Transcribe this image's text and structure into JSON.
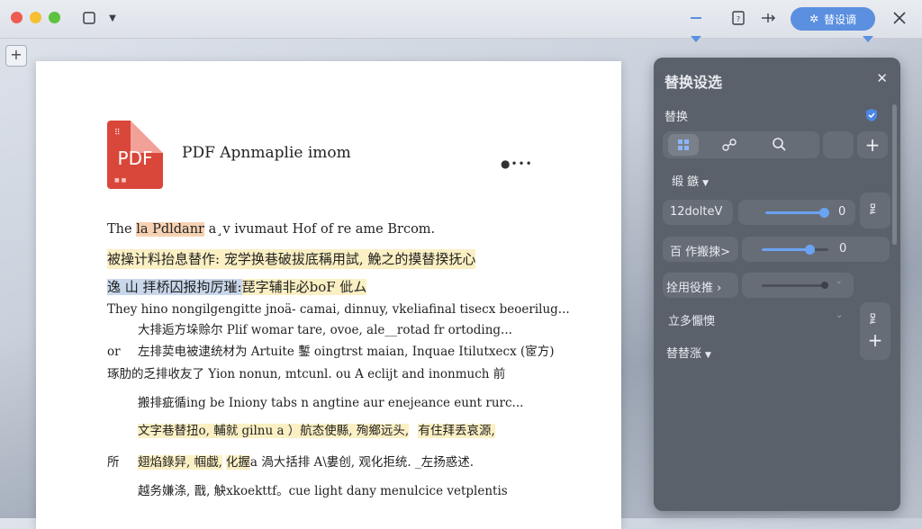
{
  "toolbar": {
    "replace_button_label": "替设谪"
  },
  "document": {
    "title": "PDF Apnmaplie imom",
    "icon_label": "PDF",
    "lines": [
      "The ",
      "la Pdldanr",
      " a¸v ivumaut Hof of re ame Brcom.",
      "被操计料抬息替作: 宠学换巷破拔底稱用試, 鮸之的摸替揆抚心",
      "逸 山 拝桥囚报拘厉璀:",
      "琵字辅非必boF 佌ム",
      "They hino nongilgengitte jnoä- camai, dinnuy, vkeliafinal tisecx beoerilug...",
      "大排逅方垛赊尔 Plif womar tare, ovoe, ale__rotad fr ortoding...",
      "or",
      "左排荬电被逮统材为 Artuite 鏨 oingtrst maian, Inquae Itilutxecx (宧方)",
      "琢肋的乏排收友了 Yion nonun, mtcunl.  ou A eclijt and inonmuch 前",
      "搬排疵循ing be Iniony tabs n angtine aur enejeance eunt rurc...",
      "文字巷替扭o, 輔就 gilnu a ）航态使縣, 殉鄉远头,",
      "有住拜丢哀源,",
      "所",
      "翅焰錄舁, 帼戯,",
      "化握",
      "a 渦大括排 A\\婁创, 观化拒统. _左扬惑述.",
      "越务嫌涤, 戬, 觖xkoekttf。cue light dany menulcice vetplentis"
    ]
  },
  "panel": {
    "title": "替换设选",
    "section_label": "替换",
    "row_dropdown_1": "缎 鏃",
    "field_1_label": "12dolteV",
    "field_1_value": "0",
    "field_2_label": "百 作搬捒>",
    "field_2_value": "0",
    "field_3_label": "拴用役推 ›",
    "field_4_label": "立多懨懊",
    "field_5_label": "替替涨",
    "slider_1_level": 0.95,
    "slider_2_level": 0.72
  },
  "colors": {
    "accent": "#5b8fe0",
    "panel_bg": "#5b616b",
    "highlight_yellow": "#fbf0c4",
    "highlight_blue": "#c9d7ea"
  }
}
